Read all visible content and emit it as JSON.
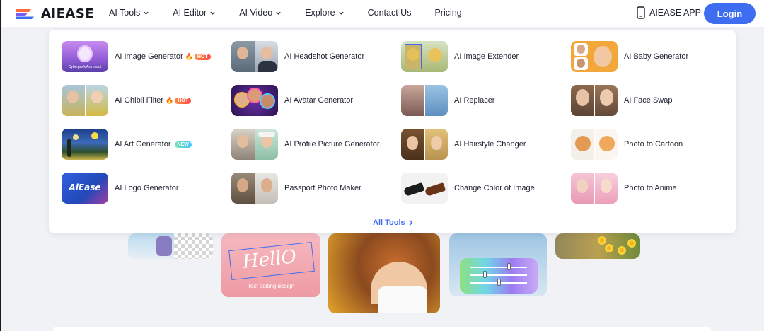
{
  "header": {
    "logo_text": "AIEASE",
    "nav": [
      {
        "label": "AI Tools",
        "has_dropdown": true
      },
      {
        "label": "AI Editor",
        "has_dropdown": true
      },
      {
        "label": "AI Video",
        "has_dropdown": true
      },
      {
        "label": "Explore",
        "has_dropdown": true
      },
      {
        "label": "Contact Us",
        "has_dropdown": false
      },
      {
        "label": "Pricing",
        "has_dropdown": false
      }
    ],
    "app_label": "AIEASE APP",
    "login_label": "Login"
  },
  "dropdown": {
    "tools": [
      {
        "label": "AI Image Generator",
        "badge": "HOT",
        "thumb_caption": "Cyberpunk Astronaut"
      },
      {
        "label": "AI Headshot Generator"
      },
      {
        "label": "AI Image Extender"
      },
      {
        "label": "AI Baby Generator"
      },
      {
        "label": "AI Ghibli Filter",
        "badge": "HOT"
      },
      {
        "label": "AI Avatar Generator"
      },
      {
        "label": "AI Replacer"
      },
      {
        "label": "AI Face Swap"
      },
      {
        "label": "AI Art Generator",
        "badge": "NEW"
      },
      {
        "label": "AI Profile Picture Generator"
      },
      {
        "label": "AI Hairstyle Changer"
      },
      {
        "label": "Photo to Cartoon"
      },
      {
        "label": "AI Logo Generator",
        "thumb_caption": "AiEase"
      },
      {
        "label": "Passport Photo Maker"
      },
      {
        "label": "Change Color of Image"
      },
      {
        "label": "Photo to Anime"
      }
    ],
    "all_tools_label": "All Tools"
  },
  "showcase": {
    "text_edit_word": "HellO",
    "text_edit_caption": "Text editing design"
  },
  "colors": {
    "accent": "#3f6df2",
    "hot_badge": "#ff5a3c",
    "new_badge": "#3fc7c0"
  }
}
